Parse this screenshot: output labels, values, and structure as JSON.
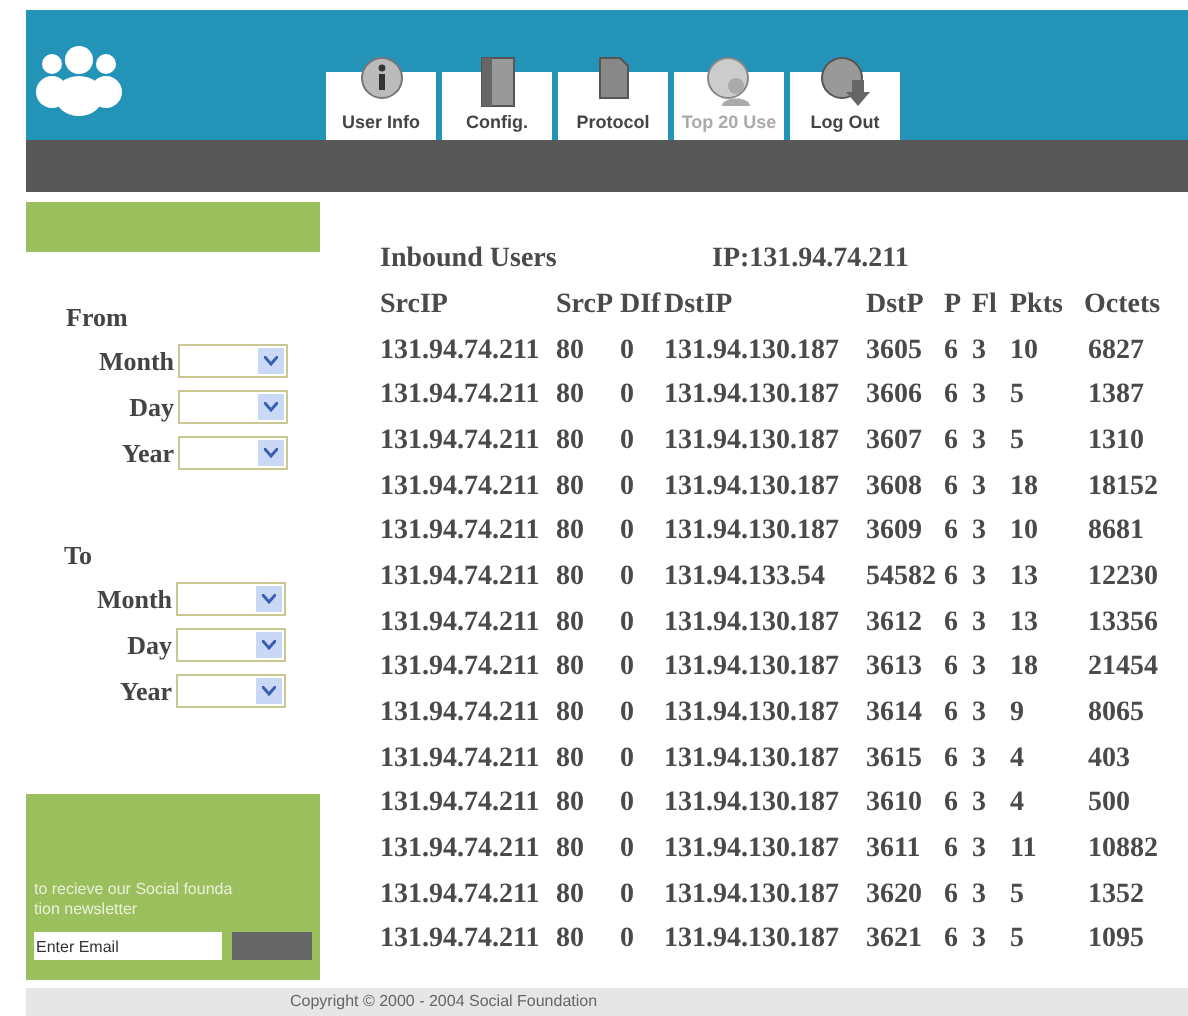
{
  "tabs": [
    {
      "label": "User Info",
      "disabled": false
    },
    {
      "label": "Config.",
      "disabled": false
    },
    {
      "label": "Protocol",
      "disabled": false
    },
    {
      "label": "Top 20 Use",
      "disabled": true
    },
    {
      "label": "Log Out",
      "disabled": false
    }
  ],
  "sidebar": {
    "groups": [
      {
        "title": "From",
        "fields": [
          "Month",
          "Day",
          "Year"
        ]
      },
      {
        "title": "To",
        "fields": [
          "Month",
          "Day",
          "Year"
        ]
      }
    ],
    "newsletter": {
      "lines": [
        "to recieve our Social founda",
        "tion newsletter"
      ],
      "placeholder": "Enter Email"
    }
  },
  "table": {
    "title": "Inbound Users",
    "ip": "IP:131.94.74.211",
    "columns": [
      "SrcIP",
      "SrcP",
      "DIf",
      "DstIP",
      "DstP",
      "P",
      "Fl",
      "Pkts",
      "Octets"
    ],
    "rows": [
      [
        "131.94.74.211",
        "80",
        "0",
        "131.94.130.187",
        "3605",
        "6",
        "3",
        "10",
        "6827"
      ],
      [
        "131.94.74.211",
        "80",
        "0",
        "131.94.130.187",
        "3606",
        "6",
        "3",
        "5",
        "1387"
      ],
      [
        "131.94.74.211",
        "80",
        "0",
        "131.94.130.187",
        "3607",
        "6",
        "3",
        "5",
        "1310"
      ],
      [
        "131.94.74.211",
        "80",
        "0",
        "131.94.130.187",
        "3608",
        "6",
        "3",
        "18",
        "18152"
      ],
      [
        "131.94.74.211",
        "80",
        "0",
        "131.94.130.187",
        "3609",
        "6",
        "3",
        "10",
        "8681"
      ],
      [
        "131.94.74.211",
        "80",
        "0",
        "131.94.133.54",
        "54582",
        "6",
        "3",
        "13",
        "12230"
      ],
      [
        "131.94.74.211",
        "80",
        "0",
        "131.94.130.187",
        "3612",
        "6",
        "3",
        "13",
        "13356"
      ],
      [
        "131.94.74.211",
        "80",
        "0",
        "131.94.130.187",
        "3613",
        "6",
        "3",
        "18",
        "21454"
      ],
      [
        "131.94.74.211",
        "80",
        "0",
        "131.94.130.187",
        "3614",
        "6",
        "3",
        "9",
        "8065"
      ],
      [
        "131.94.74.211",
        "80",
        "0",
        "131.94.130.187",
        "3615",
        "6",
        "3",
        "4",
        "403"
      ],
      [
        "131.94.74.211",
        "80",
        "0",
        "131.94.130.187",
        "3610",
        "6",
        "3",
        "4",
        "500"
      ],
      [
        "131.94.74.211",
        "80",
        "0",
        "131.94.130.187",
        "3611",
        "6",
        "3",
        "11",
        "10882"
      ],
      [
        "131.94.74.211",
        "80",
        "0",
        "131.94.130.187",
        "3620",
        "6",
        "3",
        "5",
        "1352"
      ],
      [
        "131.94.74.211",
        "80",
        "0",
        "131.94.130.187",
        "3621",
        "6",
        "3",
        "5",
        "1095"
      ]
    ]
  },
  "footer": "Copyright © 2000 - 2004 Social Foundation"
}
